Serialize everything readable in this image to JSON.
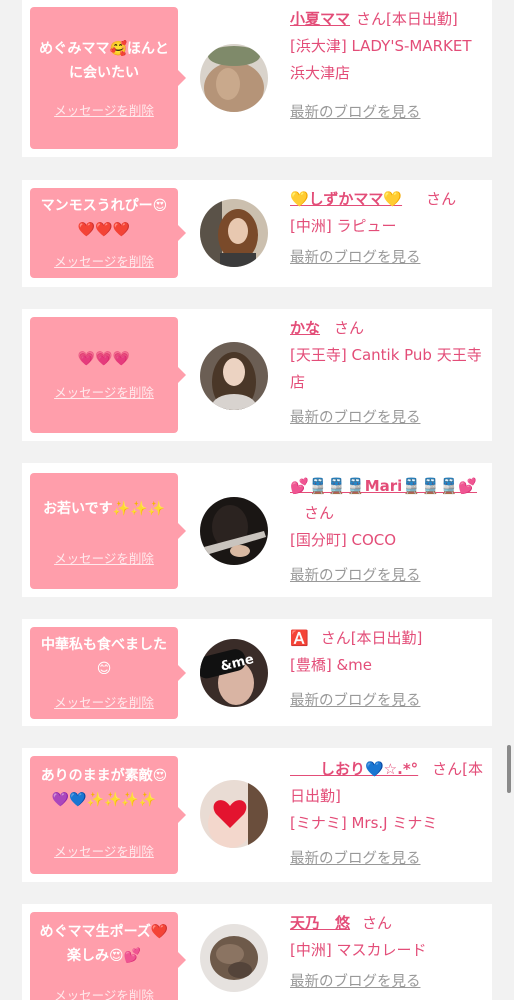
{
  "colors": {
    "accent_pink": "#ff9eab",
    "name_text": "#e34d78",
    "link_gray": "#999999",
    "background": "#f2f2f2"
  },
  "items": [
    {
      "message": "めぐみママ🥰ほんとに会いたい",
      "delete_label": "メッセージを削除",
      "name": "小夏ママ",
      "suffix": "さん[本日出勤]",
      "shop": "[浜大津] LADY'S-MARKET 浜大津店",
      "blog_label": "最新のブログを見る",
      "avatar_icon": "avatar-photo"
    },
    {
      "message": "マンモスうれぴー😍❤️❤️❤️",
      "delete_label": "メッセージを削除",
      "name": "💛しずかママ💛",
      "suffix": "さん",
      "shop": "[中洲] ラピュー",
      "blog_label": "最新のブログを見る",
      "avatar_icon": "avatar-photo"
    },
    {
      "message": "💗💗💗",
      "delete_label": "メッセージを削除",
      "name": "かな",
      "suffix": "さん",
      "shop": "[天王寺] Cantik Pub 天王寺店",
      "blog_label": "最新のブログを見る",
      "avatar_icon": "avatar-photo"
    },
    {
      "message": "お若いです✨✨✨",
      "delete_label": "メッセージを削除",
      "name": "💕🚆🚆🚆Mari🚆🚆🚆💕",
      "suffix": "さん",
      "shop": "[国分町] COCO",
      "blog_label": "最新のブログを見る",
      "avatar_icon": "avatar-photo"
    },
    {
      "message": "中華私も食べました😊",
      "delete_label": "メッセージを削除",
      "name": "🅰️",
      "suffix": "さん[本日出勤]",
      "shop": "[豊橋] &me",
      "blog_label": "最新のブログを見る",
      "avatar_icon": "avatar-photo",
      "avatar_text": "&me"
    },
    {
      "message": "ありのままが素敵😍💜💙✨✨✨✨",
      "delete_label": "メッセージを削除",
      "name": "　　しおり💙☆.*°",
      "suffix": "さん[本日出勤]",
      "shop": "[ミナミ] Mrs.J ミナミ",
      "blog_label": "最新のブログを見る",
      "avatar_icon": "avatar-photo"
    },
    {
      "message": "めぐママ生ポーズ❤️楽しみ😍💕",
      "delete_label": "メッセージを削除",
      "name": "天乃　悠",
      "suffix": "さん",
      "shop": "[中洲] マスカレード",
      "blog_label": "最新のブログを見る",
      "avatar_icon": "avatar-photo"
    }
  ]
}
